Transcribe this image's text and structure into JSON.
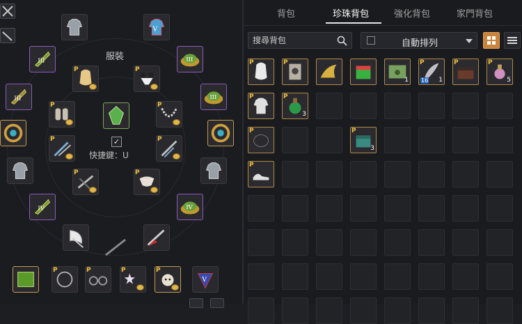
{
  "equipment": {
    "title": "服裝",
    "hotkey": "快捷鍵：U",
    "checkbox_mark": "✓"
  },
  "tabs": [
    {
      "label": "背包"
    },
    {
      "label": "珍珠背包",
      "active": true
    },
    {
      "label": "強化背包"
    },
    {
      "label": "家門背包"
    }
  ],
  "search": {
    "placeholder": "搜尋背包"
  },
  "sort": {
    "label": "自動排列"
  },
  "badges": {
    "pearl": "P",
    "slot_counts": [
      "1",
      "1",
      "5",
      "3",
      "3"
    ],
    "tl_16": "16"
  },
  "colors": {
    "accent_gold": "#c09a52",
    "pearl_p": "#f0c040",
    "purple_frame": "#8a5bbd",
    "tab_active": "#ffffff"
  }
}
